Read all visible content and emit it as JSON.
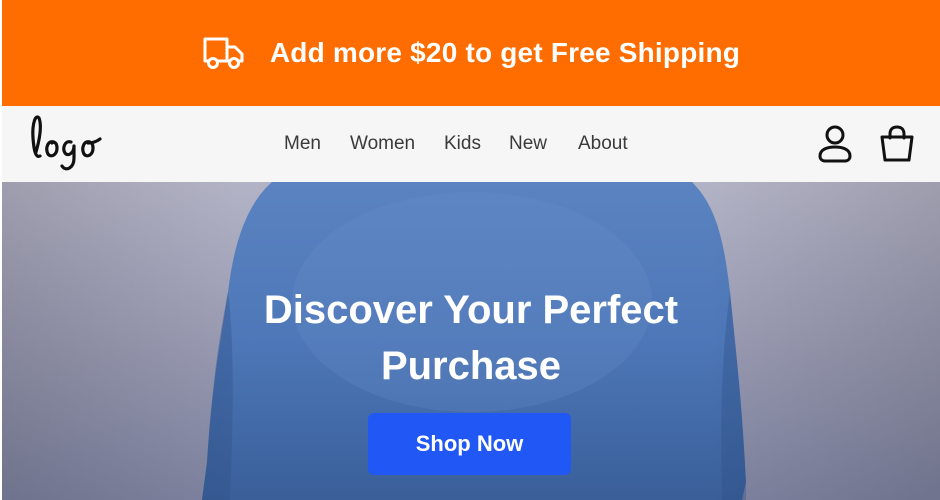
{
  "promo": {
    "icon": "truck-icon",
    "text": "Add more $20 to get Free Shipping",
    "background": "#ff6c00"
  },
  "header": {
    "logo_text": "logo",
    "nav": [
      "Men",
      "Women",
      "Kids",
      "New",
      "About"
    ],
    "icons": [
      "user-icon",
      "shopping-bag-icon"
    ]
  },
  "hero": {
    "title_line1": "Discover Your Perfect",
    "title_line2": "Purchase",
    "cta_label": "Shop Now",
    "cta_color": "#2158f5"
  }
}
